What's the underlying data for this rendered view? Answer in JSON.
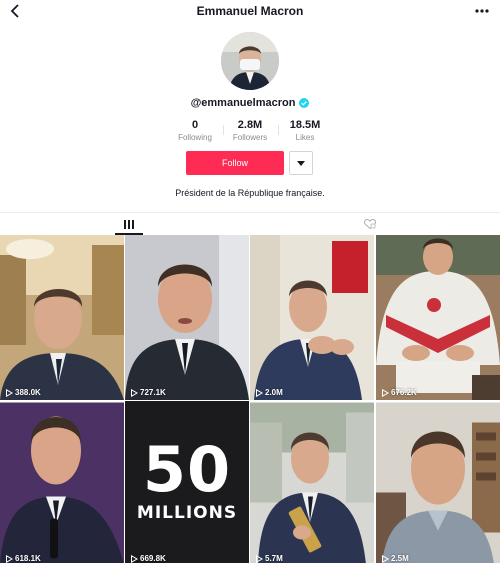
{
  "header": {
    "title": "Emmanuel Macron"
  },
  "profile": {
    "username": "@emmanuelmacron",
    "bio": "Président de la République française."
  },
  "stats": [
    {
      "value": "0",
      "label": "Following"
    },
    {
      "value": "2.8M",
      "label": "Followers"
    },
    {
      "value": "18.5M",
      "label": "Likes"
    }
  ],
  "actions": {
    "follow_label": "Follow"
  },
  "videos": [
    {
      "views": "388.0K"
    },
    {
      "views": "727.1K"
    },
    {
      "views": "2.0M"
    },
    {
      "views": "676.2K"
    },
    {
      "views": "618.1K"
    },
    {
      "views": "669.8K",
      "overlay_number": "50",
      "overlay_word": "MILLIONS"
    },
    {
      "views": "5.7M"
    },
    {
      "views": "2.5M"
    }
  ],
  "icons": {
    "back": "chevron-left-icon",
    "more": "ellipsis-icon",
    "verified": "verified-badge-icon",
    "dropdown": "caret-down-icon",
    "videos_tab": "grid-bars-icon",
    "liked_tab": "liked-heart-icon",
    "play": "play-icon"
  },
  "colors": {
    "follow": "#fe2c55",
    "verified": "#20d5ec"
  }
}
